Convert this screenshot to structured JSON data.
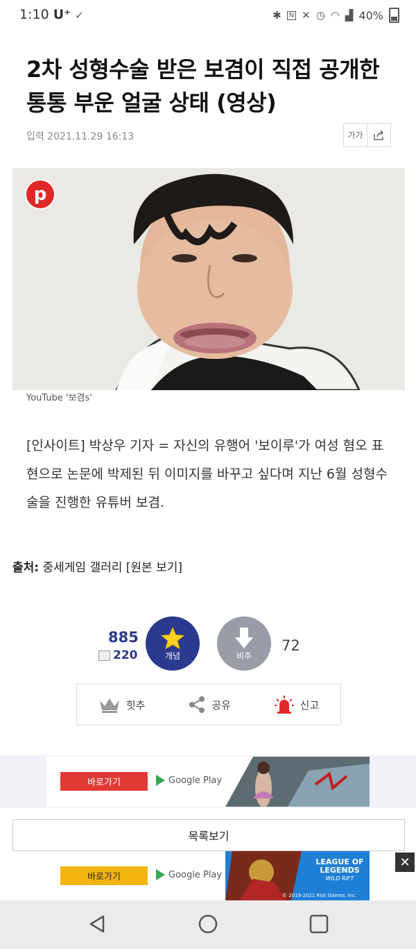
{
  "status_bar": {
    "time": "1:10",
    "carrier": "U⁺",
    "battery": "40%"
  },
  "article": {
    "headline": "2차 성형수술 받은 보겸이 직접 공개한 통통 부운 얼굴 상태 (영상)",
    "date": "입력 2021.11.29 16:13",
    "font_tool": "가가",
    "image_caption": "YouTube '보겸s'",
    "body": "[인사이트] 박상우 기자 = 자신의 유행어 '보이루'가 여성 혐오 표현으로 논문에 박제된 뒤 이미지를 바꾸고 싶다며 지난 6월 성형수술을 진행한 유튜버 보겸.",
    "pinterest_letter": "p"
  },
  "source": {
    "label": "출처:",
    "text": "중세게임 갤러리 [원본 보기]"
  },
  "votes": {
    "up_count": "885",
    "fixed_count": "220",
    "up_label": "개념",
    "down_label": "비추",
    "down_count": "72"
  },
  "actions": {
    "recommend": "힛추",
    "share": "공유",
    "report": "신고"
  },
  "ads": {
    "cta": "바로가기",
    "store": "Google Play",
    "lol_title": "LEAGUE OF LEGENDS",
    "lol_sub": "WILD RIFT",
    "copyright": "© 2019-2021 Riot Games, Inc."
  },
  "list_button": "목록보기",
  "colors": {
    "vote_up": "#2b3a8e",
    "vote_down": "#9a9da6",
    "ad1_cta": "#e13a36",
    "ad2_cta": "#f3b412"
  }
}
